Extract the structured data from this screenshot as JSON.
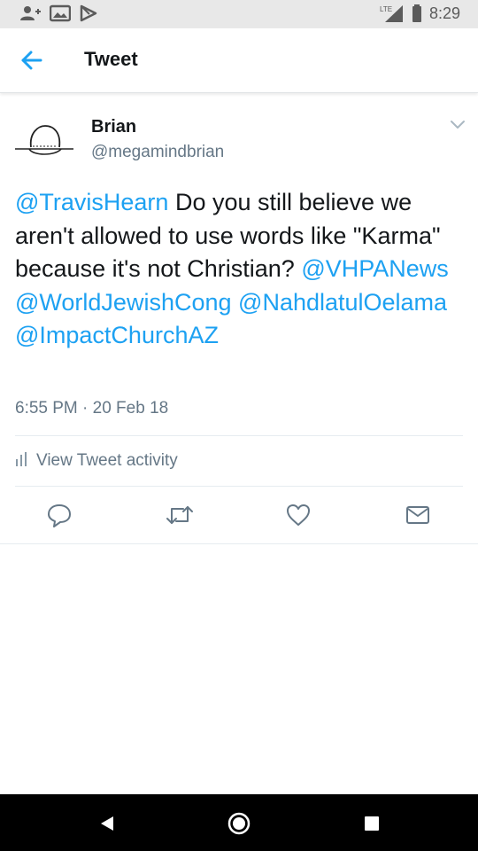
{
  "status_bar": {
    "time": "8:29",
    "network": "LTE",
    "left_icons": [
      "add-person-icon",
      "image-icon",
      "play-store-icon"
    ],
    "right_icons": [
      "lte-signal-icon",
      "battery-icon"
    ]
  },
  "header": {
    "title": "Tweet",
    "back_icon": "arrow-left-icon",
    "accent_color": "#1da1f2"
  },
  "tweet": {
    "author": {
      "name": "Brian",
      "handle": "@megamindbrian"
    },
    "mention_1": "@TravisHearn",
    "text_1": " Do you still believe we aren't allowed to use words like \"Karma\" because it's not Christian? ",
    "mention_2": "@VHPANews",
    "mention_3": "@WorldJewishCong",
    "mention_4": "@NahdlatulOelama",
    "mention_5": "@ImpactChurchAZ",
    "timestamp": "6:55 PM · 20 Feb 18",
    "activity_label": "View Tweet activity"
  },
  "actions": {
    "icons": [
      "reply-icon",
      "retweet-icon",
      "like-icon",
      "direct-message-icon"
    ]
  },
  "nav_bar": {
    "icons": [
      "back-triangle-icon",
      "home-circle-icon",
      "recents-square-icon"
    ]
  }
}
